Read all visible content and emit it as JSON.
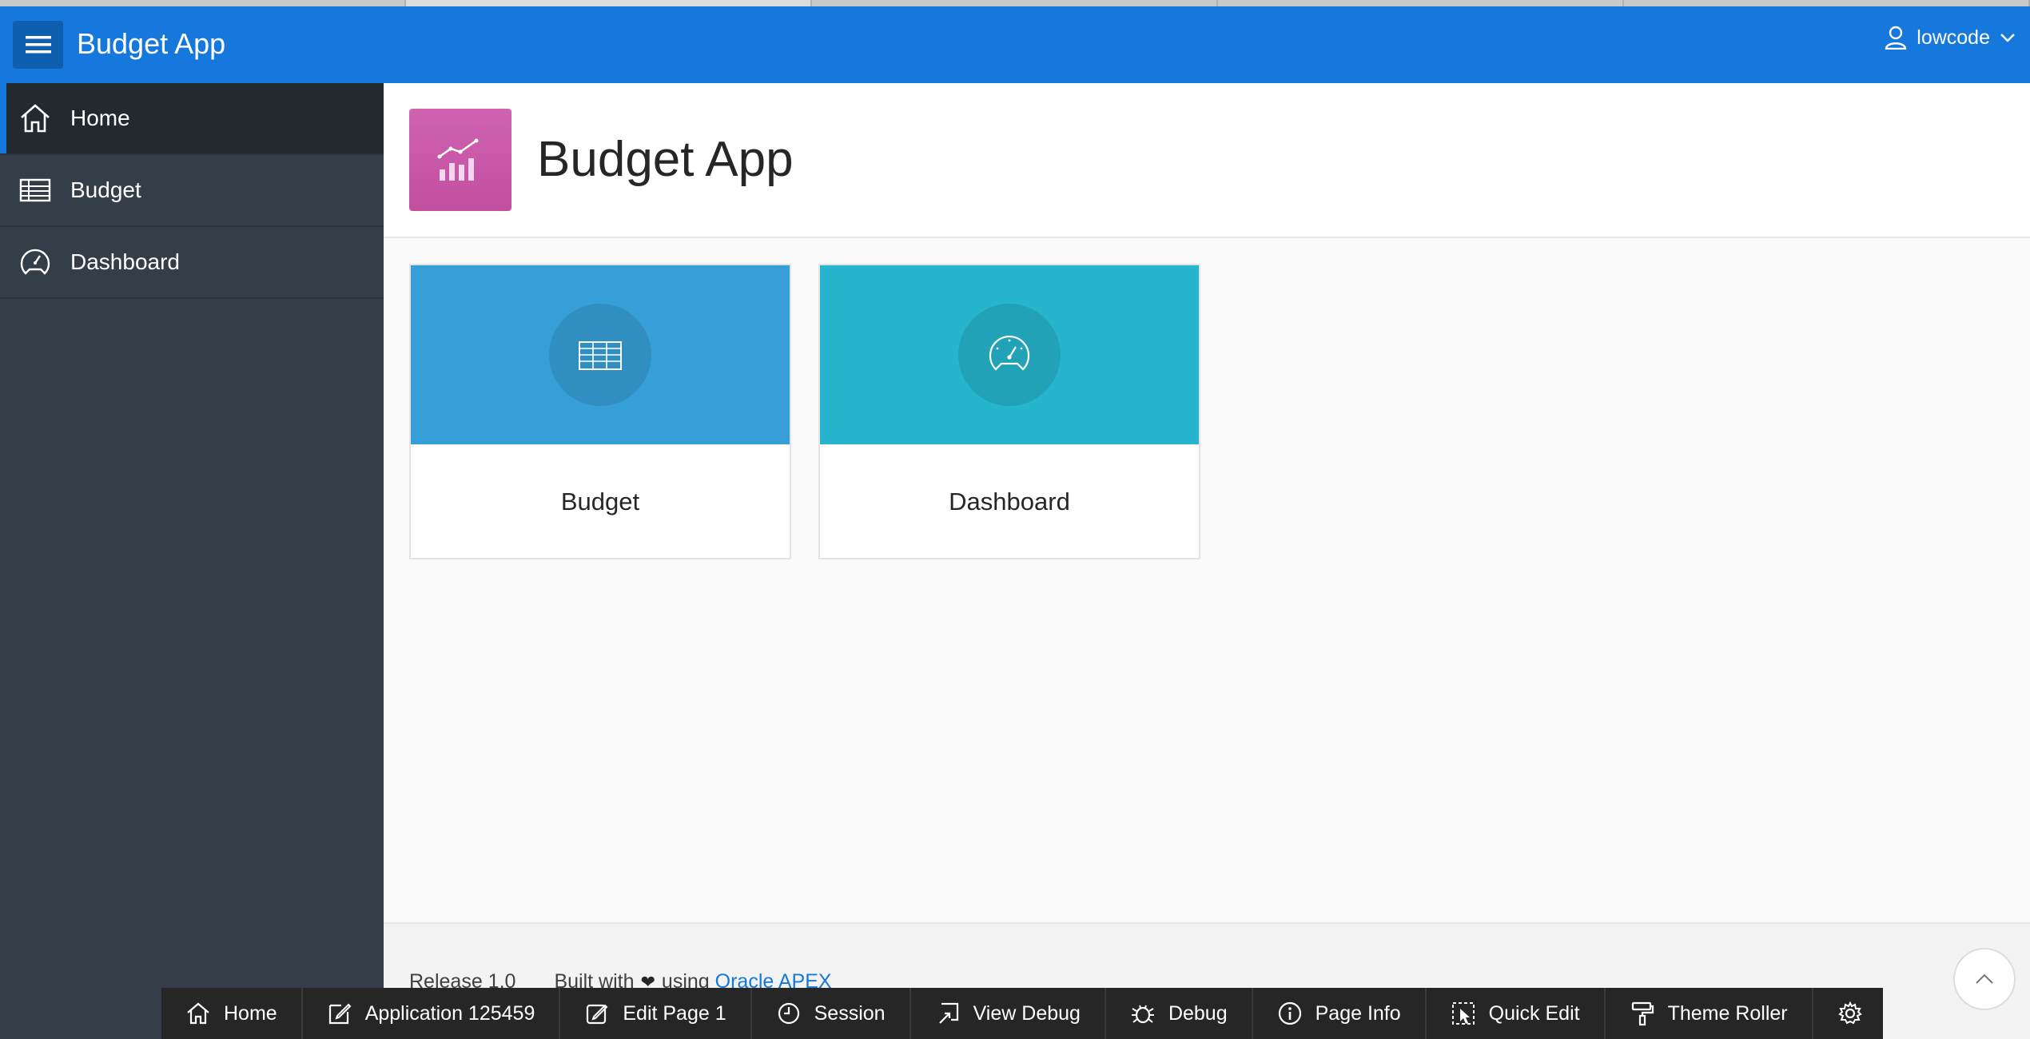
{
  "header": {
    "app_title": "Budget App",
    "username": "lowcode",
    "brand_color": "#1678dc"
  },
  "sidebar": {
    "items": [
      {
        "label": "Home",
        "icon": "home-icon",
        "active": true
      },
      {
        "label": "Budget",
        "icon": "table-icon",
        "active": false
      },
      {
        "label": "Dashboard",
        "icon": "gauge-icon",
        "active": false
      }
    ]
  },
  "hero": {
    "title": "Budget App",
    "icon": "chart-icon",
    "icon_color": "#c95aa9"
  },
  "cards": [
    {
      "label": "Budget",
      "icon": "table-icon",
      "color": "#369fd7"
    },
    {
      "label": "Dashboard",
      "icon": "gauge-icon",
      "color": "#26b5cc"
    }
  ],
  "footer": {
    "release": "Release 1.0",
    "built_with": "Built with",
    "using": "using",
    "link_text": "Oracle APEX"
  },
  "devbar": {
    "items": [
      {
        "label": "Home",
        "icon": "home-icon"
      },
      {
        "label": "Application 125459",
        "icon": "edit-icon"
      },
      {
        "label": "Edit Page 1",
        "icon": "pencil-icon"
      },
      {
        "label": "Session",
        "icon": "clock-icon"
      },
      {
        "label": "View Debug",
        "icon": "view-debug-icon"
      },
      {
        "label": "Debug",
        "icon": "bug-icon"
      },
      {
        "label": "Page Info",
        "icon": "info-icon"
      },
      {
        "label": "Quick Edit",
        "icon": "quick-edit-icon"
      },
      {
        "label": "Theme Roller",
        "icon": "paint-roller-icon"
      },
      {
        "label": "",
        "icon": "gear-icon"
      }
    ]
  }
}
